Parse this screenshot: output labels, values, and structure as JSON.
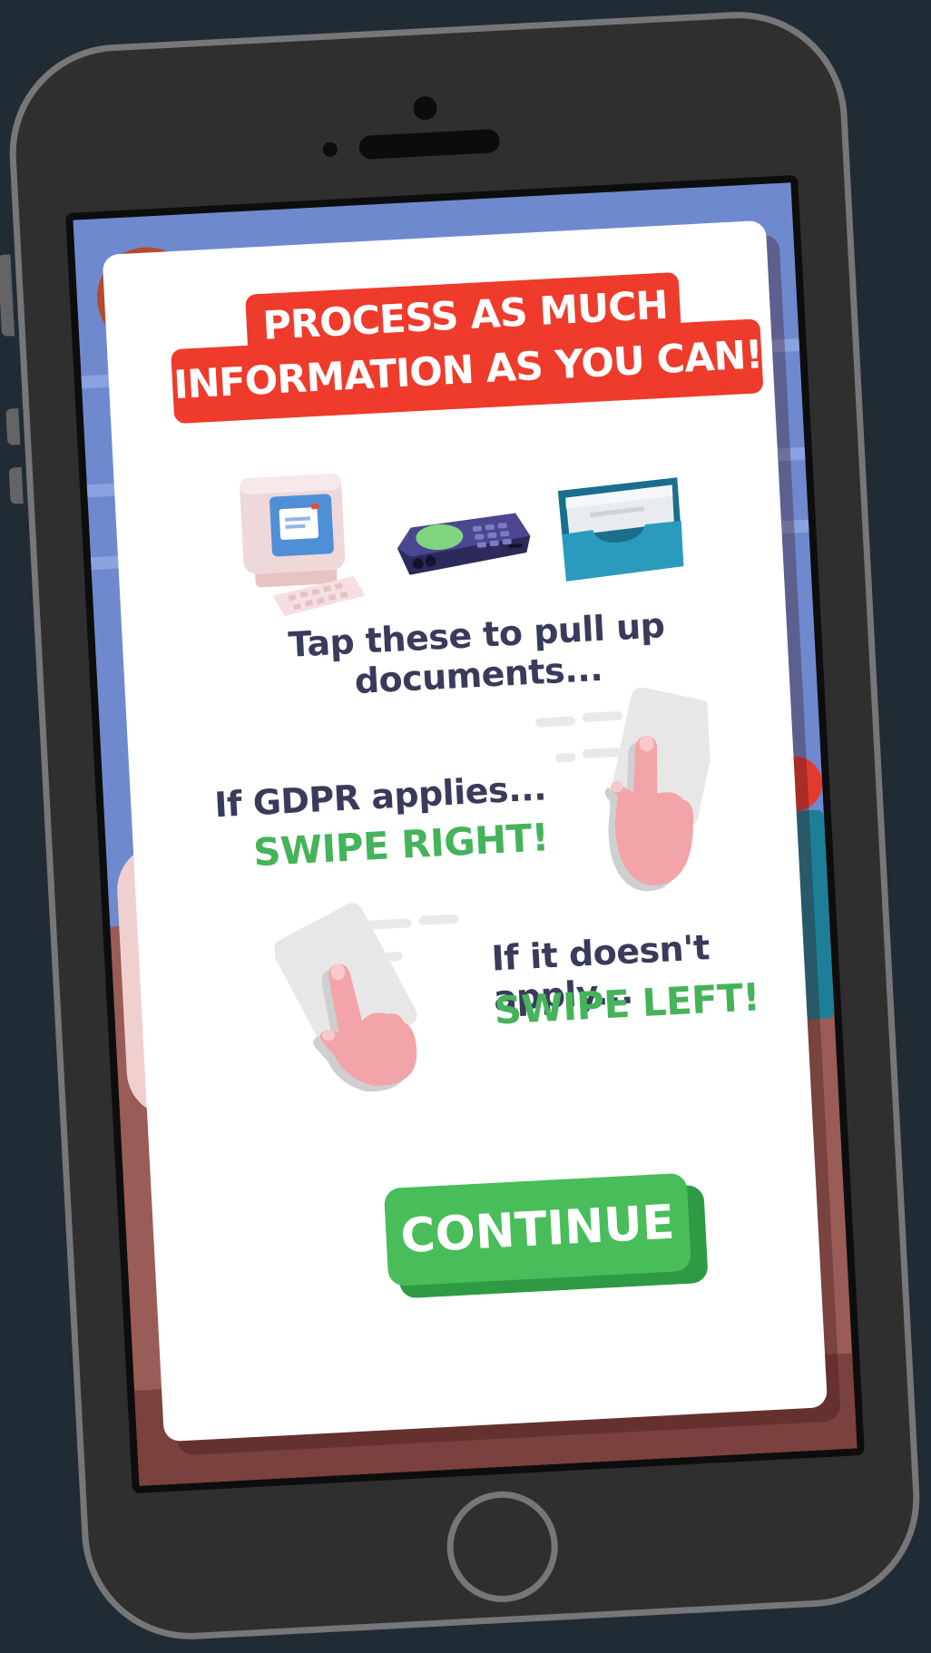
{
  "dialog": {
    "title_line1": "PROCESS AS MUCH",
    "title_line2": "INFORMATION AS YOU CAN!",
    "tap_instruction": "Tap these to pull up documents...",
    "gdpr_applies": "If GDPR applies...",
    "swipe_right": "SWIPE RIGHT!",
    "not_applies": "If it doesn't apply...",
    "swipe_left": "SWIPE LEFT!",
    "continue_label": "CONTINUE"
  },
  "icons": {
    "computer": "computer-icon",
    "phone": "desk-phone-icon",
    "inbox": "inbox-tray-icon",
    "swipe_right": "swipe-right-hand-icon",
    "swipe_left": "swipe-left-hand-icon"
  },
  "colors": {
    "background": "#212b33",
    "banner_red": "#ee3b2b",
    "accent_green": "#48bd5a",
    "text_navy": "#393b5b",
    "hand_pink": "#f2a4a8"
  }
}
